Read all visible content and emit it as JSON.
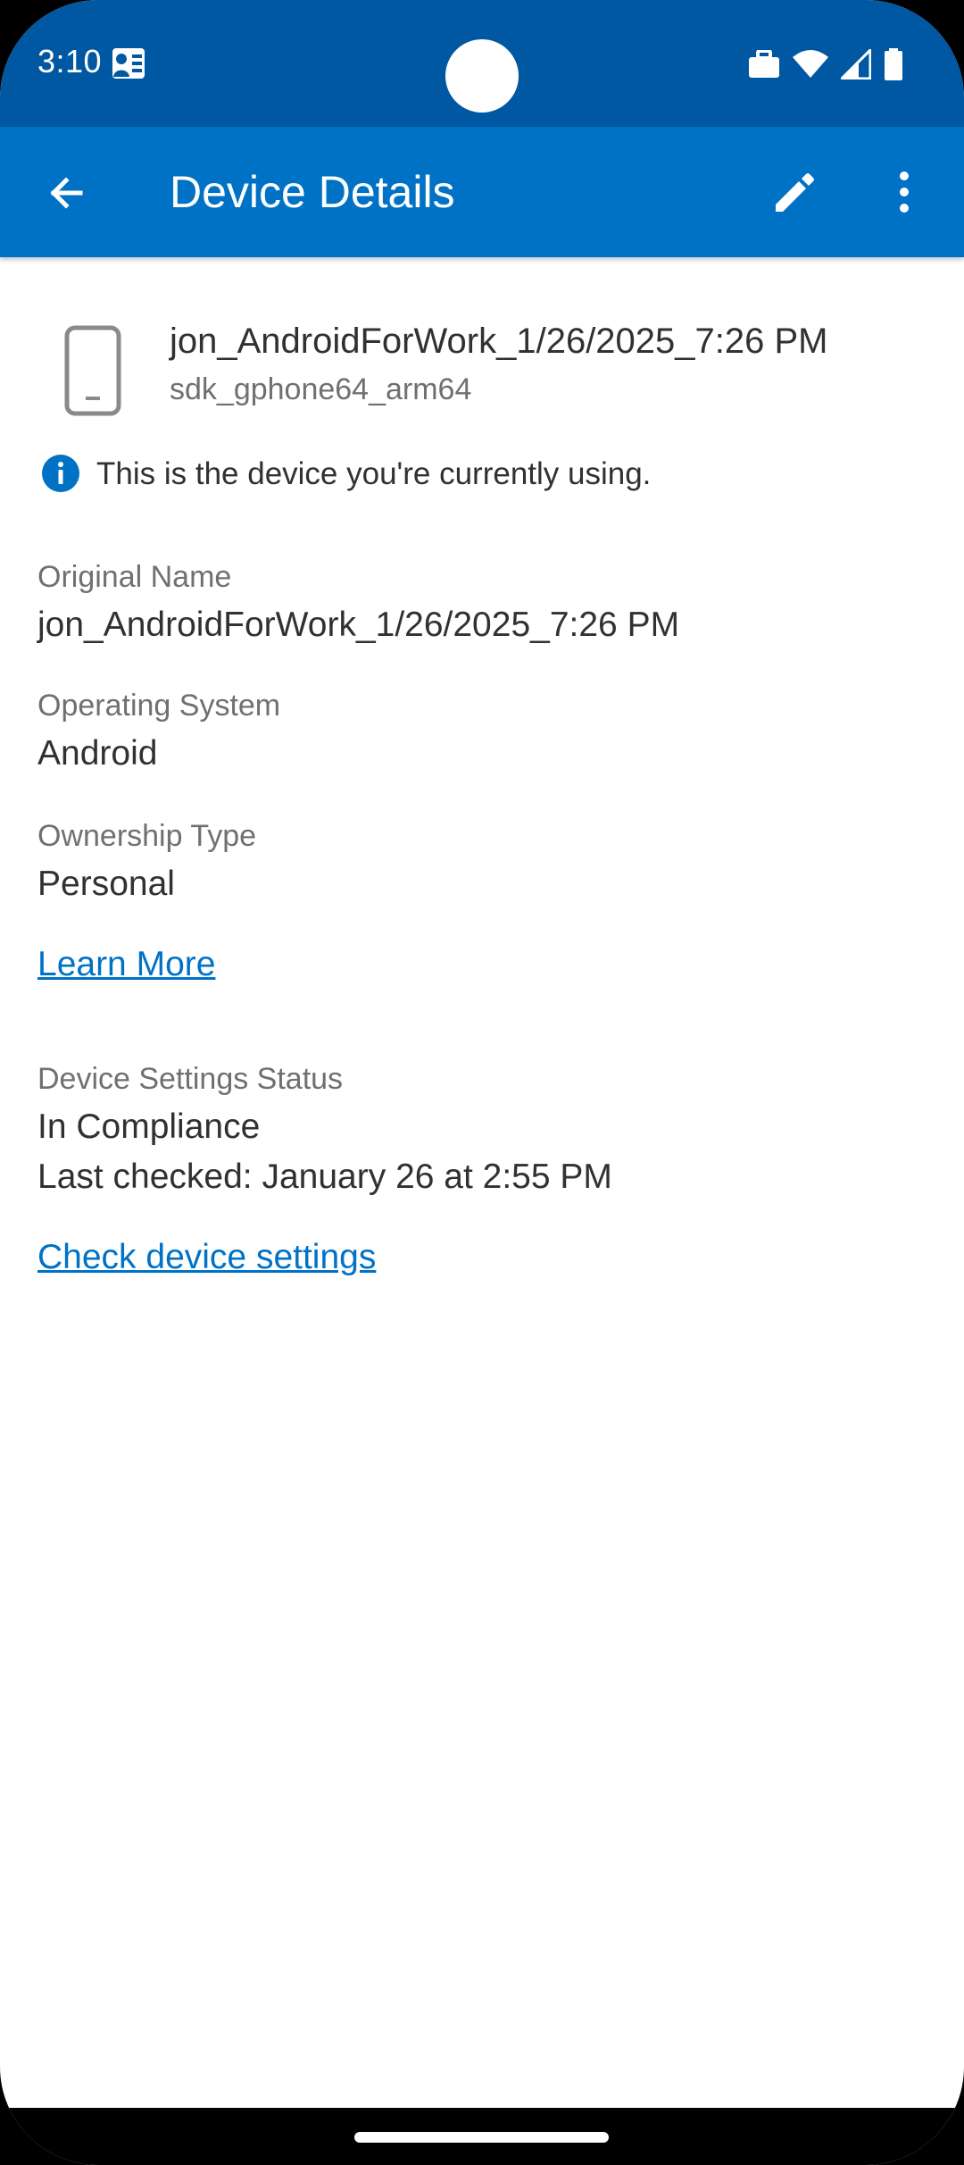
{
  "status_bar": {
    "time": "3:10",
    "icons": [
      "contacts-badge-icon",
      "briefcase-icon",
      "wifi-icon",
      "cell-signal-icon",
      "battery-icon"
    ]
  },
  "app_bar": {
    "title": "Device Details",
    "icons": {
      "back": "arrow-left-icon",
      "edit": "pencil-icon",
      "more": "more-vertical-icon"
    }
  },
  "device": {
    "name": "jon_AndroidForWork_1/26/2025_7:26 PM",
    "model": "sdk_gphone64_arm64",
    "icon": "smartphone-icon",
    "current_note": "This is the device you're currently using."
  },
  "details": {
    "original_name_label": "Original Name",
    "original_name_value": "jon_AndroidForWork_1/26/2025_7:26 PM",
    "os_label": "Operating System",
    "os_value": "Android",
    "ownership_label": "Ownership Type",
    "ownership_value": "Personal",
    "learn_more": "Learn More",
    "settings_status_label": "Device Settings Status",
    "settings_status_value": "In Compliance",
    "last_checked": "Last checked: January 26 at 2:55 PM",
    "check_settings": "Check device settings"
  },
  "colors": {
    "status_bar": "#0058A3",
    "app_bar": "#0072C6",
    "link": "#0072C6",
    "text_primary": "#323130",
    "text_secondary": "#707070"
  }
}
